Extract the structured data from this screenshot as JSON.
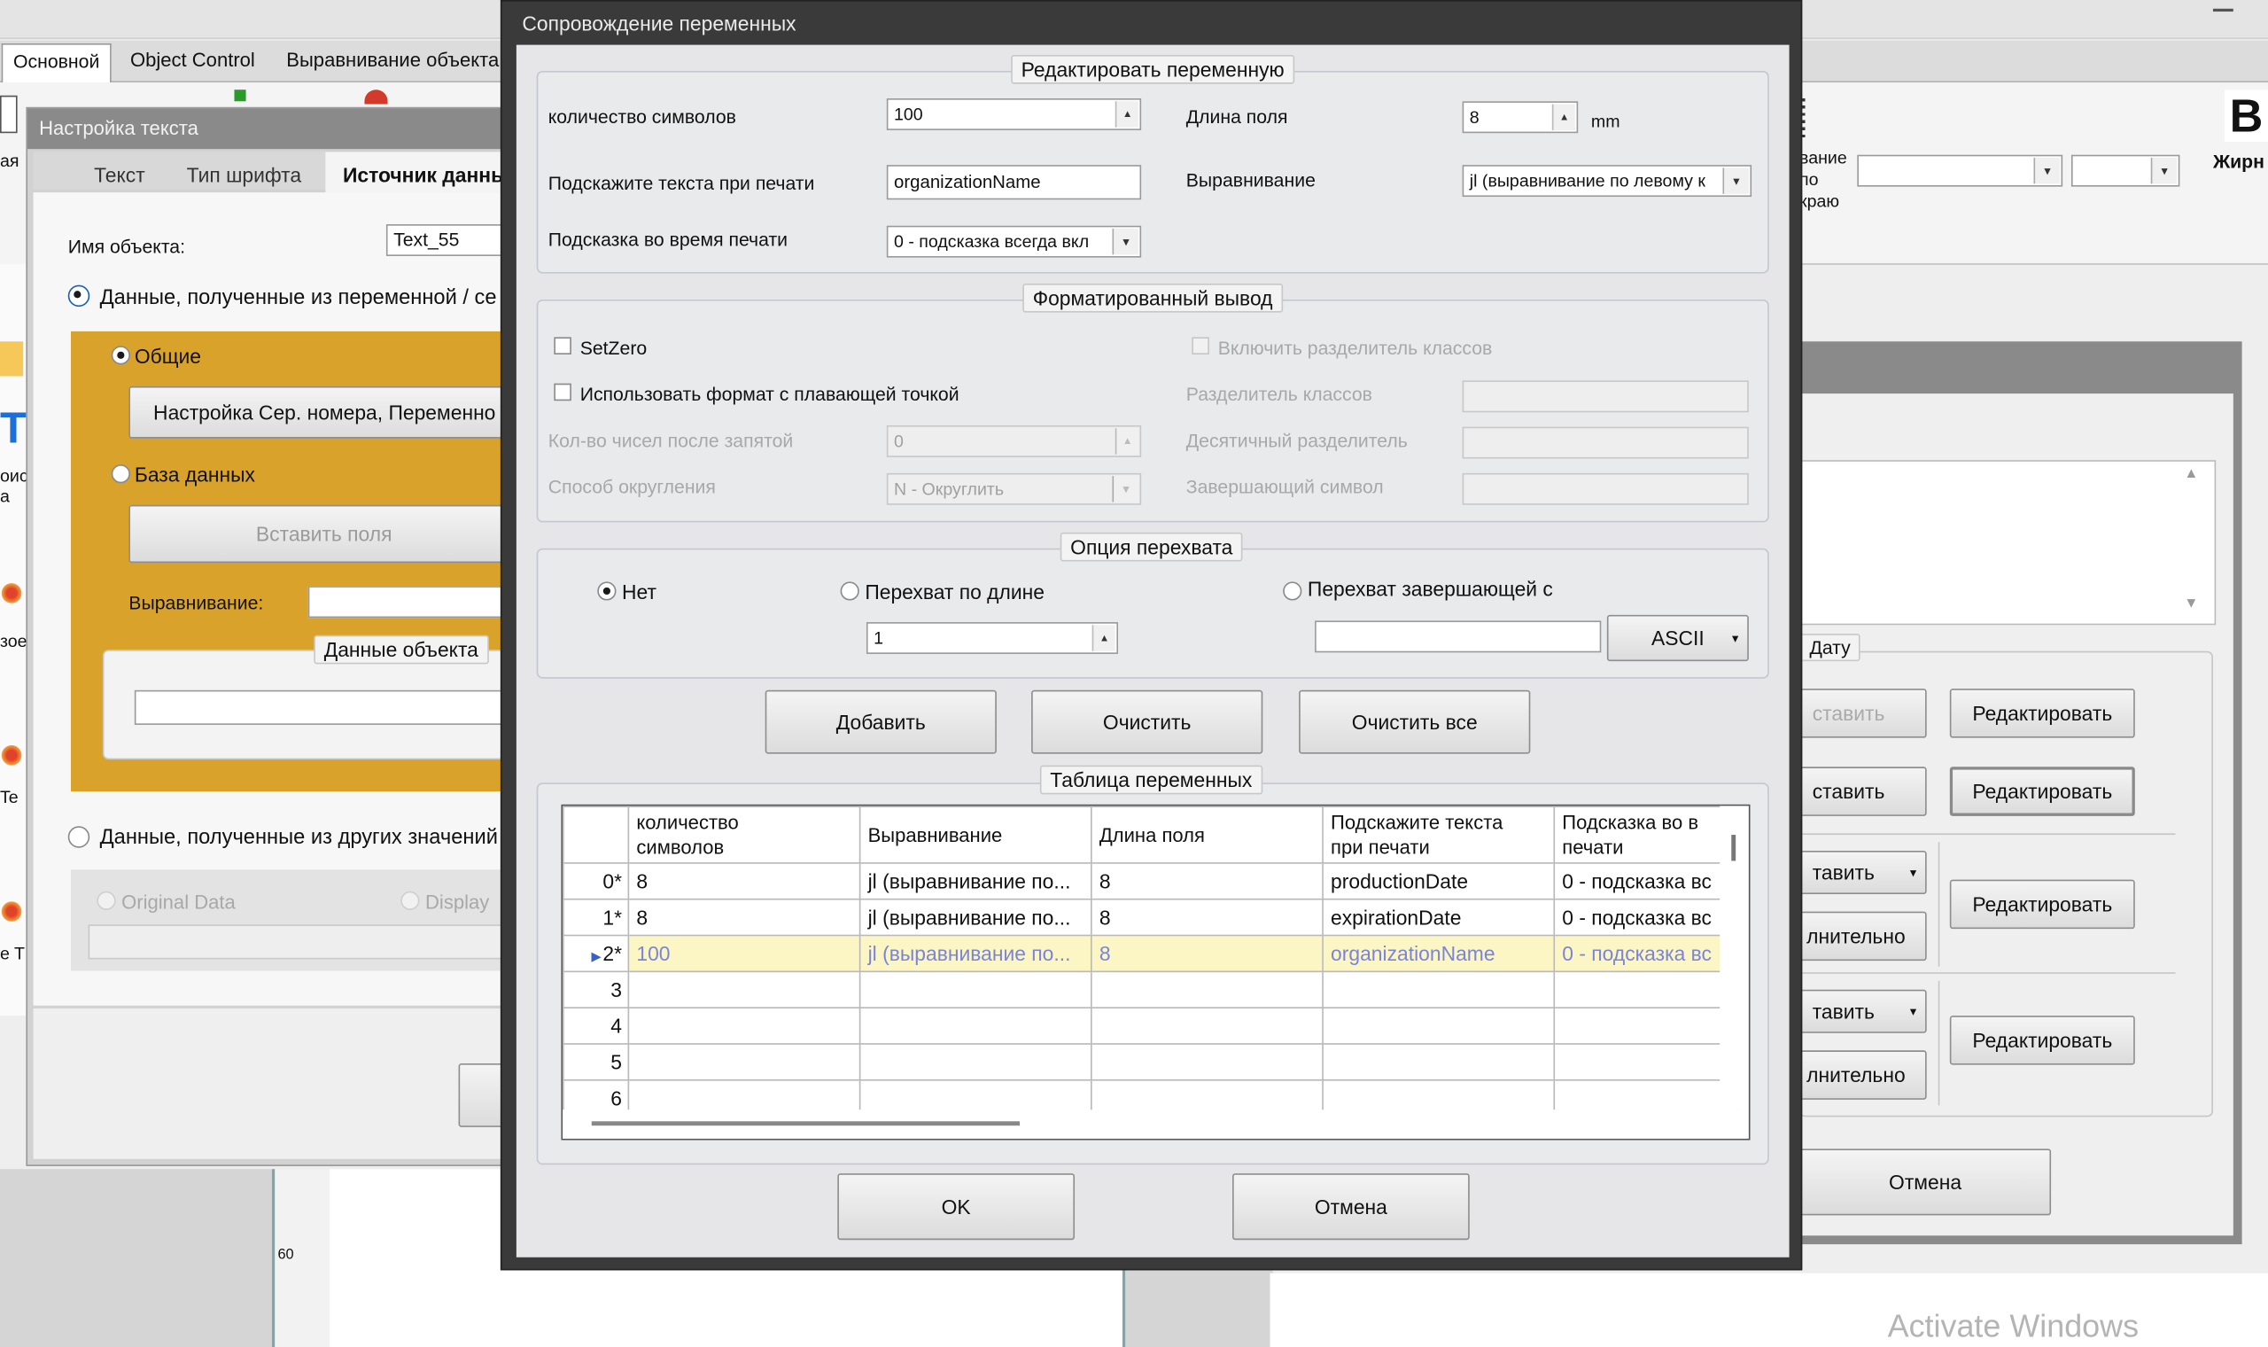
{
  "ribbon": {
    "tabs": [
      "Основной",
      "Object Control",
      "Выравнивание объекта"
    ],
    "right_letter": "В",
    "right_label": "Жирн",
    "align_text": "вание\nпо\nкраю"
  },
  "text_settings": {
    "title": "Настройка текста",
    "tabs": [
      "Текст",
      "Тип шрифта",
      "Источник данны"
    ],
    "object_name_label": "Имя объекта:",
    "object_name_value": "Text_55",
    "radio_variable_label": "Данные, полученные из переменной / се",
    "general_label": "Общие",
    "serial_button": "Настройка Сер. номера, Переменно",
    "database_label": "База данных",
    "insert_fields": "Вставить поля",
    "alignment_label": "Выравнивание:",
    "object_data": "Данные объекта",
    "radio_other_label": "Данные, полученные из других значений",
    "original_data": "Original Data",
    "display_label": "Display"
  },
  "left_strip": [
    "ая",
    "T",
    "оис\nа",
    "зое",
    "Te",
    "e T"
  ],
  "ruler_label": "60",
  "right_dialog": {
    "date_label": "Дату",
    "insert_label": "ставить",
    "insert_label2": "ставить",
    "insert_drop1": "тавить",
    "insert_drop2": "тавить",
    "extra1": "лнительно",
    "extra2": "лнительно",
    "edit_buttons": [
      "Редактировать",
      "Редактировать",
      "Редактировать",
      "Редактировать"
    ],
    "cancel": "Отмена"
  },
  "dialog": {
    "title": "Сопровождение переменных",
    "edit_group": {
      "title": "Редактировать переменную",
      "char_count_label": "количество символов",
      "char_count_value": "100",
      "field_length_label": "Длина поля",
      "field_length_value": "8",
      "unit": "mm",
      "prompt_text_label": "Подскажите текста при печати",
      "prompt_text_value": "organizationName",
      "alignment_label": "Выравнивание",
      "alignment_value": "jl (выравнивание по левому к",
      "prompt_mode_label": "Подсказка во время печати",
      "prompt_mode_value": "0 - подсказка всегда вкл"
    },
    "format_group": {
      "title": "Форматированный вывод",
      "setzero": "SetZero",
      "float_format": "Использовать формат с плавающей точкой",
      "decimals_label": "Кол-во чисел после запятой",
      "decimals_value": "0",
      "rounding_label": "Способ округления",
      "rounding_value": "N - Округлить",
      "class_sep_enable": "Включить разделитель классов",
      "class_sep_label": "Разделитель классов",
      "decimal_sep_label": "Десятичный разделитель",
      "terminator_label": "Завершающий символ"
    },
    "intercept_group": {
      "title": "Опция перехвата",
      "none": "Нет",
      "by_length": "Перехват по длине",
      "length_value": "1",
      "by_terminator": "Перехват завершающей с",
      "ascii": "ASCII"
    },
    "buttons": {
      "add": "Добавить",
      "clear": "Очистить",
      "clear_all": "Очистить все",
      "ok": "OK",
      "cancel": "Отмена"
    },
    "table": {
      "title": "Таблица переменных",
      "columns": [
        "количество\nсимволов",
        "Выравнивание",
        "Длина поля",
        "Подскажите текста\nпри печати",
        "Подсказка во в\nпечати"
      ],
      "rows": [
        {
          "id": "0*",
          "cells": [
            "8",
            "jl (выравнивание по...",
            "8",
            "productionDate",
            "0 - подсказка вс"
          ]
        },
        {
          "id": "1*",
          "cells": [
            "8",
            "jl (выравнивание по...",
            "8",
            "expirationDate",
            "0 - подсказка вс"
          ]
        },
        {
          "id": "2*",
          "cells": [
            "100",
            "jl (выравнивание по...",
            "8",
            "organizationName",
            "0 - подсказка вс"
          ]
        },
        {
          "id": "3",
          "cells": [
            "",
            "",
            "",
            "",
            ""
          ]
        },
        {
          "id": "4",
          "cells": [
            "",
            "",
            "",
            "",
            ""
          ]
        },
        {
          "id": "5",
          "cells": [
            "",
            "",
            "",
            "",
            ""
          ]
        },
        {
          "id": "6",
          "cells": [
            "",
            "",
            "",
            "",
            ""
          ]
        }
      ]
    }
  },
  "watermark": "Activate Windows",
  "colors": {
    "dialog_title_bar": "#3a3a3a",
    "dialog_body": "#e6e6e8",
    "orange_panel": "#d9a32b",
    "selected_row": "#fbf6c4",
    "selected_text": "#7a84d8"
  }
}
